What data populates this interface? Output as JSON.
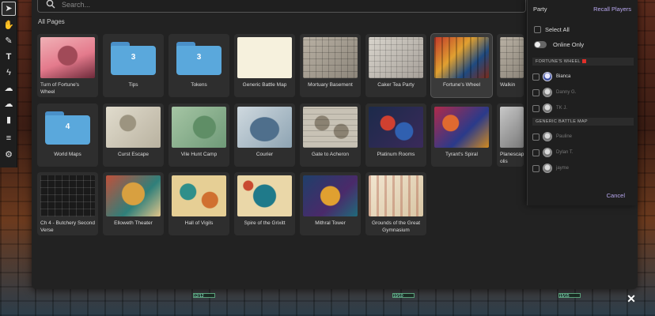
{
  "search": {
    "placeholder": "Search..."
  },
  "section_title": "All Pages",
  "cards": [
    {
      "label": "Turn of Fortune's Wheel",
      "kind": "map",
      "style": "t-art"
    },
    {
      "label": "Tips",
      "kind": "folder",
      "count": "3"
    },
    {
      "label": "Tokens",
      "kind": "folder",
      "count": "3"
    },
    {
      "label": "Generic Battle Map",
      "kind": "map",
      "style": "t-paper"
    },
    {
      "label": "Mortuary Basement",
      "kind": "map",
      "style": "t-grid"
    },
    {
      "label": "Caker Tea Party",
      "kind": "map",
      "style": "t-grid2"
    },
    {
      "label": "Fortune's Wheel",
      "kind": "map",
      "style": "t-fortune",
      "selected": true
    },
    {
      "label": "Walkin",
      "kind": "map",
      "style": "t-grid"
    },
    {
      "label": "World Maps",
      "kind": "folder",
      "count": "4"
    },
    {
      "label": "Curst Escape",
      "kind": "map",
      "style": "t-curst"
    },
    {
      "label": "Vile Hunt Camp",
      "kind": "map",
      "style": "t-vile"
    },
    {
      "label": "Courier",
      "kind": "map",
      "style": "t-courier"
    },
    {
      "label": "Gate to Acheron",
      "kind": "map",
      "style": "t-gate"
    },
    {
      "label": "Platinum Rooms",
      "kind": "map",
      "style": "t-plat"
    },
    {
      "label": "Tyrant's Spiral",
      "kind": "map",
      "style": "t-tyrant"
    },
    {
      "label": "Planescap olis",
      "kind": "map",
      "style": "t-planes"
    },
    {
      "label": "Ch 4 - Butchery Second Verse",
      "kind": "map",
      "style": "t-ch4"
    },
    {
      "label": "Elloweth Theater",
      "kind": "map",
      "style": "t-ello"
    },
    {
      "label": "Hall of Vigils",
      "kind": "map",
      "style": "t-vigils"
    },
    {
      "label": "Spire of the Grixitt",
      "kind": "map",
      "style": "t-spire"
    },
    {
      "label": "Mithral Tower",
      "kind": "map",
      "style": "t-mithral"
    },
    {
      "label": "Grounds of the Great Gymnasium",
      "kind": "map",
      "style": "t-grounds"
    }
  ],
  "party": {
    "title": "Party",
    "recall_label": "Recall Players",
    "select_all": "Select All",
    "online_only": "Online Only",
    "groups": [
      {
        "name": "FORTUNE'S WHEEL",
        "players": [
          {
            "name": "Bianca",
            "online": true
          },
          {
            "name": "Danny G.",
            "online": false
          },
          {
            "name": "TK J.",
            "online": false
          }
        ]
      },
      {
        "name": "GENERIC BATTLE MAP",
        "players": [
          {
            "name": "Pauline",
            "online": false
          },
          {
            "name": "Dylan T.",
            "online": false
          },
          {
            "name": "jayme",
            "online": false
          }
        ]
      }
    ],
    "cancel_label": "Cancel"
  },
  "tools": [
    "cursor-icon",
    "hand-icon",
    "brush-icon",
    "text-icon",
    "lightning-icon",
    "fog-icon",
    "cloud-icon",
    "note-icon",
    "list-icon",
    "settings-icon"
  ],
  "hud": {
    "left": "12/12",
    "mid": "10/10",
    "right": "15/15"
  }
}
